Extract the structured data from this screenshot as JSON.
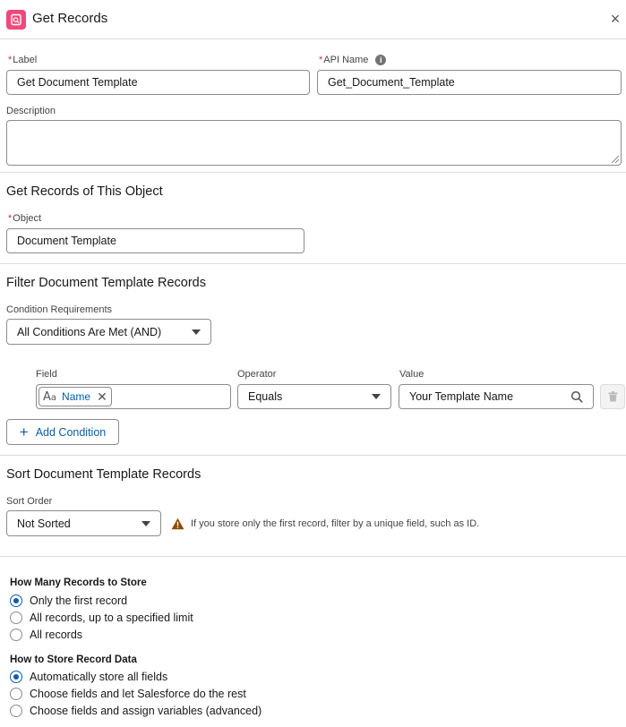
{
  "header": {
    "title": "Get Records",
    "icon": "get-records-icon",
    "accent": "#f1487c"
  },
  "label_field": {
    "label": "Label",
    "value": "Get Document Template"
  },
  "api_field": {
    "label": "API Name",
    "value": "Get_Document_Template"
  },
  "description_field": {
    "label": "Description",
    "value": ""
  },
  "object_section": {
    "title": "Get Records of This Object",
    "object_label": "Object",
    "object_value": "Document Template"
  },
  "filter_section": {
    "title": "Filter Document Template Records",
    "condition_label": "Condition Requirements",
    "condition_value": "All Conditions Are Met (AND)",
    "columns": {
      "field": "Field",
      "operator": "Operator",
      "value": "Value"
    },
    "row": {
      "field": "Name",
      "operator": "Equals",
      "value": "Your Template Name"
    },
    "add_condition": "Add Condition"
  },
  "sort_section": {
    "title": "Sort Document Template Records",
    "sort_label": "Sort Order",
    "sort_value": "Not Sorted",
    "warning": "If you store only the first record, filter by a unique field, such as ID."
  },
  "store_how_many": {
    "title": "How Many Records to Store",
    "options": [
      "Only the first record",
      "All records, up to a specified limit",
      "All records"
    ],
    "selected": 0
  },
  "store_how": {
    "title": "How to Store Record Data",
    "options": [
      "Automatically store all fields",
      "Choose fields and let Salesforce do the rest",
      "Choose fields and assign variables (advanced)"
    ],
    "selected": 0
  }
}
